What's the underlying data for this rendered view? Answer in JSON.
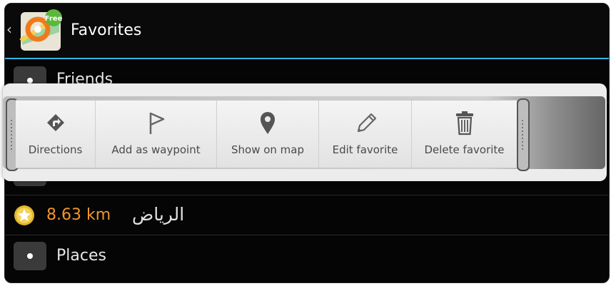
{
  "header": {
    "title": "Favorites",
    "back_icon": "chevron-left-icon",
    "app_icon": "osmand-app-icon",
    "app_badge": "Free"
  },
  "list": {
    "groups": [
      {
        "label": "Friends",
        "icon": "dot-icon"
      },
      {
        "label": "Places",
        "icon": "dot-icon"
      }
    ],
    "favorite": {
      "distance": "8.63 km",
      "name": "الرياض",
      "icon": "star-icon"
    }
  },
  "actions": [
    {
      "label": "Directions",
      "icon": "directions-icon"
    },
    {
      "label": "Add as waypoint",
      "icon": "flag-icon"
    },
    {
      "label": "Show on map",
      "icon": "map-pin-icon"
    },
    {
      "label": "Edit favorite",
      "icon": "pencil-icon"
    },
    {
      "label": "Delete favorite",
      "icon": "trash-icon"
    }
  ],
  "colors": {
    "accent": "#33b5e5",
    "distance": "#f0962c",
    "background": "#050505"
  }
}
